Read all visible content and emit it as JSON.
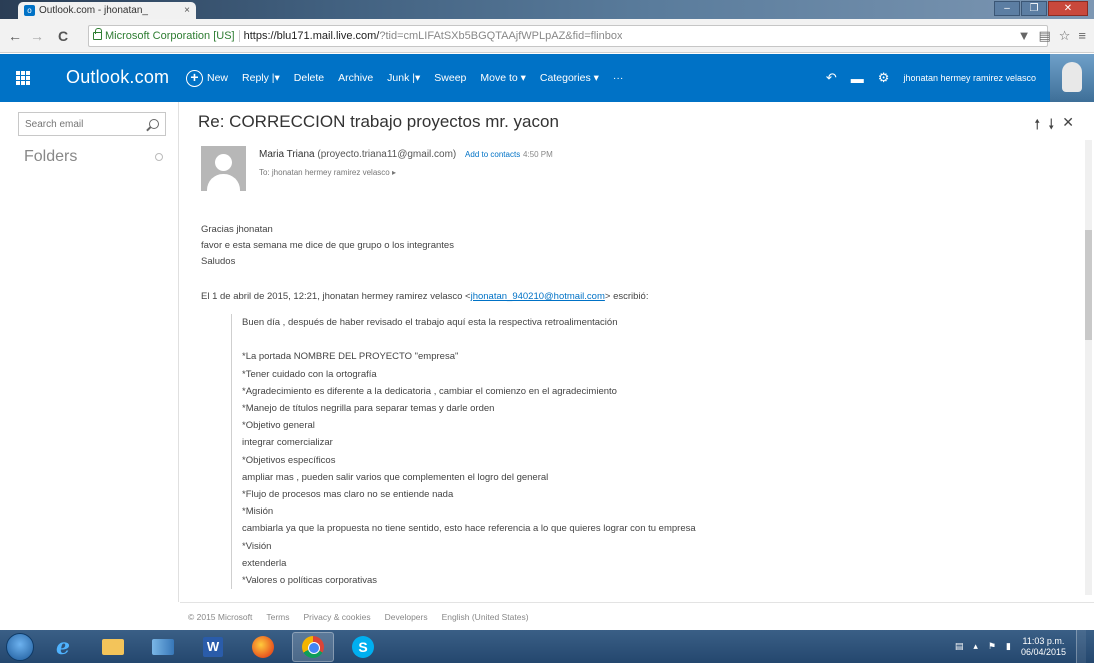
{
  "browser": {
    "tab_title": "Outlook.com - jhonatan_",
    "tab_close": "×",
    "ev_label": "Microsoft Corporation [US]",
    "url_host": "https://blu171.mail.live.com/",
    "url_rest": "?tid=cmLIFAtSXb5BGQTAAjfWPLpAZ&fid=flinbox"
  },
  "outlook": {
    "brand": "Outlook.com",
    "toolbar": {
      "new": "New",
      "reply": "Reply |▾",
      "delete": "Delete",
      "archive": "Archive",
      "junk": "Junk |▾",
      "sweep": "Sweep",
      "move_to": "Move to ▾",
      "categories": "Categories ▾",
      "more": "···"
    },
    "user_name": "jhonatan hermey ramirez velasco"
  },
  "left_pane": {
    "search_placeholder": "Search email",
    "folders_label": "Folders"
  },
  "message": {
    "subject": "Re: CORRECCION trabajo proyectos mr. yacon",
    "sender_name": "Maria Triana",
    "sender_email": "(proyecto.triana11@gmail.com)",
    "add_to_contacts": "Add to contacts",
    "sent_time": "4:50 PM",
    "to_line": "To: jhonatan hermey ramirez velasco ▸",
    "body": [
      "Gracias jhonatan",
      "favor e esta semana me dice de que grupo o los integrantes",
      "Saludos"
    ],
    "quote_header_prefix": "El 1 de abril de 2015, 12:21, jhonatan hermey ramirez velasco <",
    "quote_header_link": "jhonatan_940210@hotmail.com",
    "quote_header_suffix": "> escribió:",
    "quoted_lines": [
      "Buen día , después de haber revisado el trabajo aquí esta la respectiva retroalimentación",
      "",
      "*La portada NOMBRE DEL PROYECTO \"empresa\"",
      "*Tener cuidado con la ortografía",
      "*Agradecimiento es diferente a la dedicatoria , cambiar el comienzo en el agradecimiento",
      "*Manejo de títulos negrilla para separar temas y darle orden",
      "*Objetivo general",
      "integrar comercializar",
      "*Objetivos específicos",
      "ampliar mas , pueden salir varios que complementen el logro del general",
      "*Flujo de procesos mas claro no se entiende nada",
      "*Misión",
      "cambiarla ya que la propuesta no tiene sentido, esto hace referencia a lo que quieres lograr con tu empresa",
      "*Visión",
      "extenderla",
      "*Valores o políticas corporativas"
    ]
  },
  "footer": {
    "copyright": "© 2015 Microsoft",
    "terms": "Terms",
    "privacy": "Privacy & cookies",
    "developers": "Developers",
    "language": "English (United States)"
  },
  "taskbar": {
    "word_label": "W",
    "skype_label": "S",
    "clock_time": "11:03 p.m.",
    "clock_date": "06/04/2015"
  }
}
